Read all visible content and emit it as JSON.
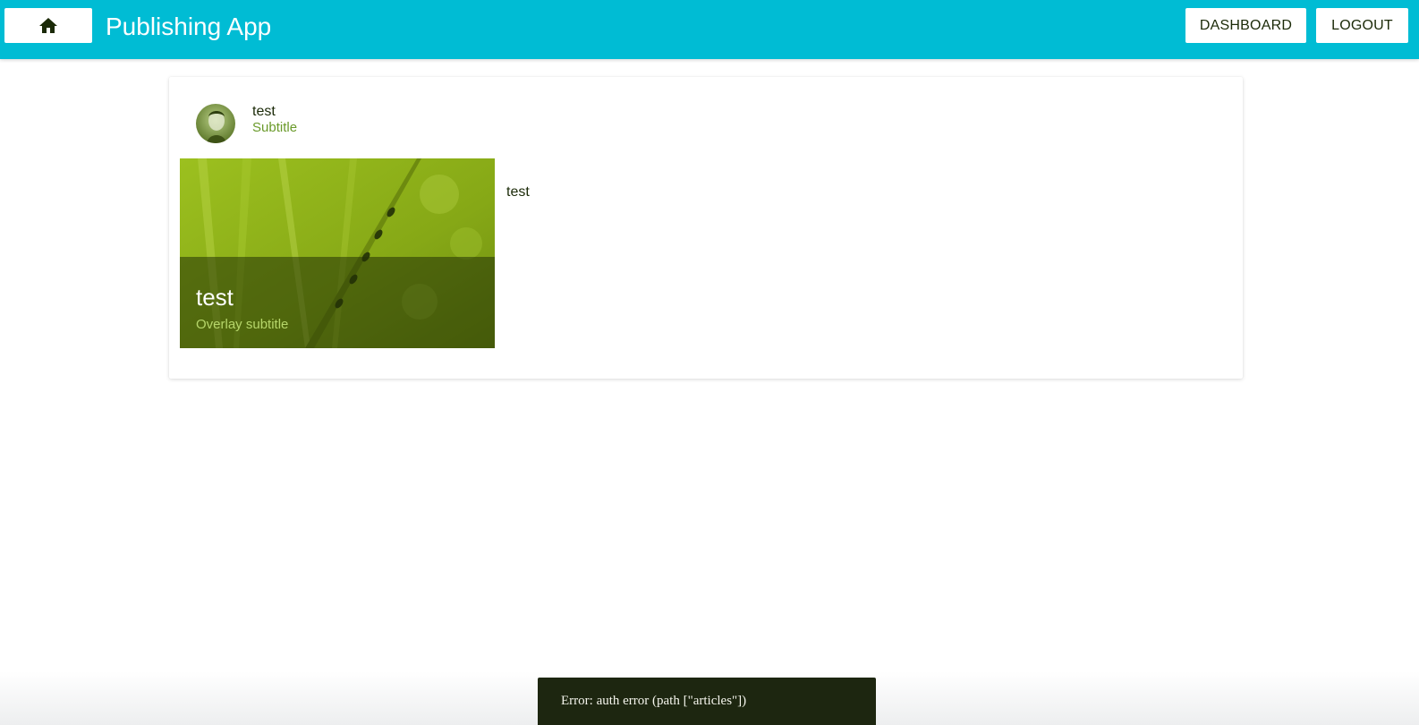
{
  "appbar": {
    "title": "Publishing App",
    "home_icon": "home-icon",
    "dashboard_label": "DASHBOARD",
    "logout_label": "LOGOUT",
    "background_color": "#00bcd4"
  },
  "card": {
    "header": {
      "title": "test",
      "subtitle": "Subtitle",
      "avatar_icon": "avatar-photo"
    },
    "media": {
      "overlay_title": "test",
      "overlay_subtitle": "Overlay subtitle"
    },
    "text": "test"
  },
  "snackbar": {
    "message": "Error: auth error (path [\"articles\"])"
  }
}
